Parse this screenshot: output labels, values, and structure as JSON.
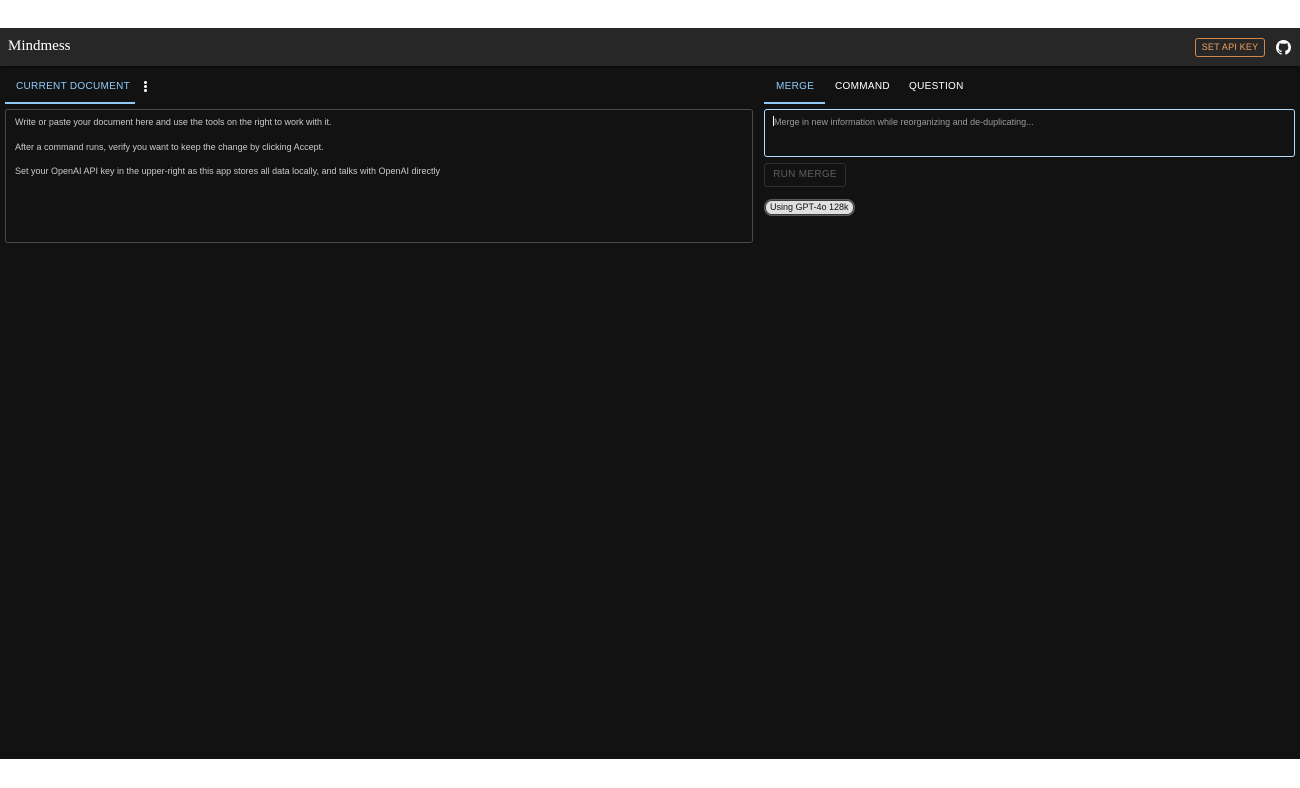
{
  "app": {
    "title": "Mindmess",
    "api_key_button": "SET API KEY",
    "github_icon": "github-icon"
  },
  "left": {
    "tab_label": "CURRENT DOCUMENT",
    "menu_icon": "more-vert-icon",
    "document_lines": [
      "Write or paste your document here and use the tools on the right to work with it.",
      "After a command runs, verify you want to keep the change by clicking Accept.",
      "Set your OpenAI API key in the upper-right as this app stores all data locally, and talks with OpenAI directly"
    ]
  },
  "right": {
    "tabs": [
      {
        "label": "MERGE",
        "active": true
      },
      {
        "label": "COMMAND",
        "active": false
      },
      {
        "label": "QUESTION",
        "active": false
      }
    ],
    "merge_placeholder": "Merge in new information while reorganizing and de-duplicating...",
    "run_button": "RUN MERGE",
    "model_chip": "Using GPT-4o 128k"
  },
  "colors": {
    "background": "#121212",
    "topbar": "#272727",
    "accent": "#90caf9",
    "api_button": "#f0a25c"
  }
}
